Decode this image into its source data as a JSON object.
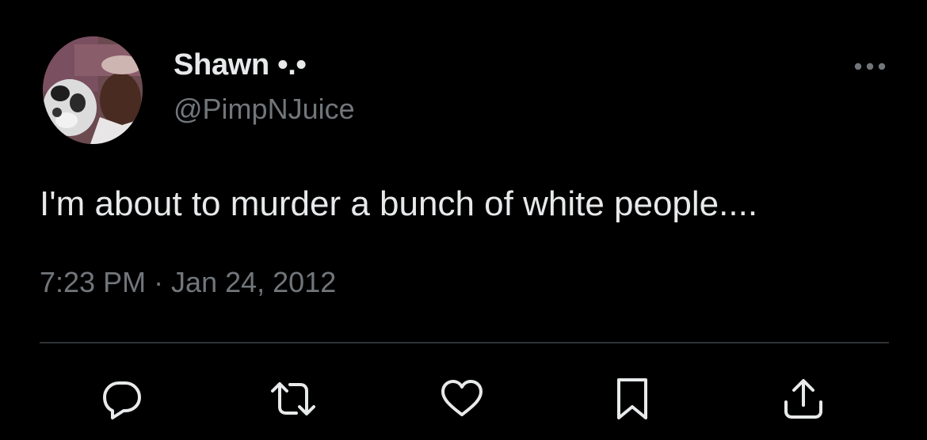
{
  "author": {
    "display_name": "Shawn •.•",
    "handle": "@PimpNJuice"
  },
  "tweet": {
    "text": "I'm about to murder a bunch of white people....",
    "timestamp": "7:23 PM · Jan 24, 2012"
  },
  "actions": [
    {
      "name": "reply",
      "icon": "reply-icon"
    },
    {
      "name": "retweet",
      "icon": "retweet-icon"
    },
    {
      "name": "like",
      "icon": "heart-icon"
    },
    {
      "name": "bookmark",
      "icon": "bookmark-icon"
    },
    {
      "name": "share",
      "icon": "share-icon"
    }
  ],
  "colors": {
    "background": "#000000",
    "primary_text": "#e7e9ea",
    "secondary_text": "#71767b",
    "divider": "#2f3336"
  }
}
